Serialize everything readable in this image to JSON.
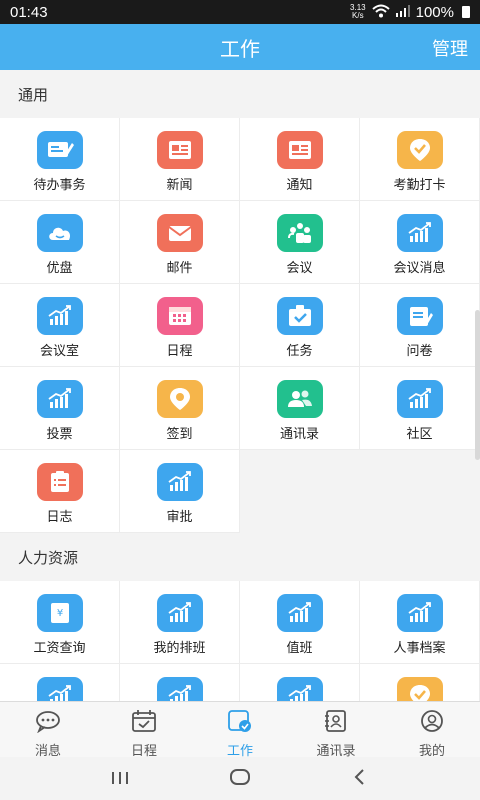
{
  "status": {
    "time": "01:43",
    "net_speed_top": "3.13",
    "net_speed_unit": "K/s",
    "battery": "100%"
  },
  "header": {
    "title": "工作",
    "manage_label": "管理"
  },
  "sections": [
    {
      "title": "通用",
      "items": [
        {
          "label": "待办事务",
          "icon": "todo-icon",
          "color": "#3ea6ee"
        },
        {
          "label": "新闻",
          "icon": "newspaper-icon",
          "color": "#f0705a"
        },
        {
          "label": "通知",
          "icon": "newspaper-icon",
          "color": "#f0705a"
        },
        {
          "label": "考勤打卡",
          "icon": "location-check-icon",
          "color": "#f6b54a"
        },
        {
          "label": "优盘",
          "icon": "cloud-icon",
          "color": "#3ea6ee"
        },
        {
          "label": "邮件",
          "icon": "mail-icon",
          "color": "#f0705a"
        },
        {
          "label": "会议",
          "icon": "meeting-icon",
          "color": "#22c08e"
        },
        {
          "label": "会议消息",
          "icon": "chart-icon",
          "color": "#3ea6ee"
        },
        {
          "label": "会议室",
          "icon": "chart-icon",
          "color": "#3ea6ee"
        },
        {
          "label": "日程",
          "icon": "calendar-icon",
          "color": "#f2608c"
        },
        {
          "label": "任务",
          "icon": "task-icon",
          "color": "#3ea6ee"
        },
        {
          "label": "问卷",
          "icon": "survey-icon",
          "color": "#3ea6ee"
        },
        {
          "label": "投票",
          "icon": "chart-icon",
          "color": "#3ea6ee"
        },
        {
          "label": "签到",
          "icon": "location-pin-icon",
          "color": "#f6b54a"
        },
        {
          "label": "通讯录",
          "icon": "contacts-icon",
          "color": "#22c08e"
        },
        {
          "label": "社区",
          "icon": "chart-icon",
          "color": "#3ea6ee"
        },
        {
          "label": "日志",
          "icon": "log-icon",
          "color": "#f0705a"
        },
        {
          "label": "审批",
          "icon": "chart-icon",
          "color": "#3ea6ee"
        }
      ]
    },
    {
      "title": "人力资源",
      "items": [
        {
          "label": "工资查询",
          "icon": "salary-icon",
          "color": "#3ea6ee"
        },
        {
          "label": "我的排班",
          "icon": "chart-icon",
          "color": "#3ea6ee"
        },
        {
          "label": "值班",
          "icon": "chart-icon",
          "color": "#3ea6ee"
        },
        {
          "label": "人事档案",
          "icon": "chart-icon",
          "color": "#3ea6ee"
        },
        {
          "label": "",
          "icon": "chart-icon",
          "color": "#3ea6ee"
        },
        {
          "label": "",
          "icon": "chart-icon",
          "color": "#3ea6ee"
        },
        {
          "label": "",
          "icon": "chart-icon",
          "color": "#3ea6ee"
        },
        {
          "label": "",
          "icon": "location-check-icon",
          "color": "#f6b54a"
        }
      ]
    }
  ],
  "bottom_nav": [
    {
      "label": "消息",
      "icon": "message-icon",
      "active": false
    },
    {
      "label": "日程",
      "icon": "calendar-check-icon",
      "active": false
    },
    {
      "label": "工作",
      "icon": "work-icon",
      "active": true
    },
    {
      "label": "通讯录",
      "icon": "address-book-icon",
      "active": false
    },
    {
      "label": "我的",
      "icon": "profile-icon",
      "active": false
    }
  ],
  "colors": {
    "primary": "#48b0ef",
    "active_nav": "#2e9fe8"
  }
}
